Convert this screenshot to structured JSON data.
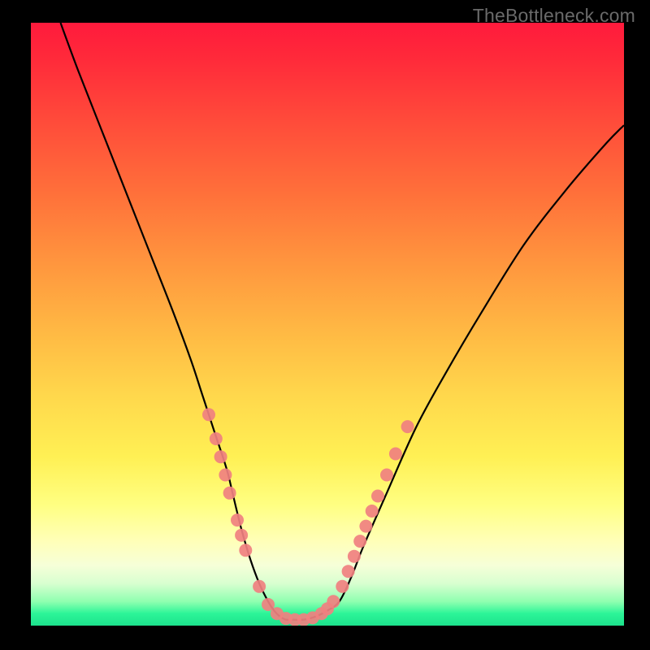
{
  "watermark": "TheBottleneck.com",
  "chart_data": {
    "type": "line",
    "title": "",
    "xlabel": "",
    "ylabel": "",
    "xlim": [
      0,
      100
    ],
    "ylim": [
      0,
      100
    ],
    "series": [
      {
        "name": "bottleneck-curve",
        "x": [
          5,
          8,
          12,
          16,
          20,
          24,
          27,
          29,
          31,
          33,
          34,
          35.5,
          37,
          38.5,
          40,
          41,
          42,
          43,
          44,
          46,
          48,
          50,
          52,
          54,
          56,
          60,
          65,
          70,
          76,
          83,
          90,
          97,
          100
        ],
        "y": [
          100,
          92,
          82,
          72,
          62,
          52,
          44,
          38,
          32,
          26,
          22,
          16,
          11,
          7,
          4,
          2.5,
          1.5,
          1,
          1,
          1,
          1.5,
          2.5,
          4,
          8,
          13,
          22,
          33,
          42,
          52,
          63,
          72,
          80,
          83
        ]
      }
    ],
    "markers": {
      "name": "highlight-points",
      "color": "#f08080",
      "points": [
        {
          "x": 30.0,
          "y": 35.0
        },
        {
          "x": 31.2,
          "y": 31.0
        },
        {
          "x": 32.0,
          "y": 28.0
        },
        {
          "x": 32.8,
          "y": 25.0
        },
        {
          "x": 33.5,
          "y": 22.0
        },
        {
          "x": 34.8,
          "y": 17.5
        },
        {
          "x": 35.5,
          "y": 15.0
        },
        {
          "x": 36.2,
          "y": 12.5
        },
        {
          "x": 38.5,
          "y": 6.5
        },
        {
          "x": 40.0,
          "y": 3.5
        },
        {
          "x": 41.5,
          "y": 2.0
        },
        {
          "x": 43.0,
          "y": 1.2
        },
        {
          "x": 44.5,
          "y": 1.0
        },
        {
          "x": 46.0,
          "y": 1.0
        },
        {
          "x": 47.5,
          "y": 1.3
        },
        {
          "x": 49.0,
          "y": 2.0
        },
        {
          "x": 50.0,
          "y": 2.8
        },
        {
          "x": 51.0,
          "y": 4.0
        },
        {
          "x": 52.5,
          "y": 6.5
        },
        {
          "x": 53.5,
          "y": 9.0
        },
        {
          "x": 54.5,
          "y": 11.5
        },
        {
          "x": 55.5,
          "y": 14.0
        },
        {
          "x": 56.5,
          "y": 16.5
        },
        {
          "x": 57.5,
          "y": 19.0
        },
        {
          "x": 58.5,
          "y": 21.5
        },
        {
          "x": 60.0,
          "y": 25.0
        },
        {
          "x": 61.5,
          "y": 28.5
        },
        {
          "x": 63.5,
          "y": 33.0
        }
      ]
    }
  }
}
